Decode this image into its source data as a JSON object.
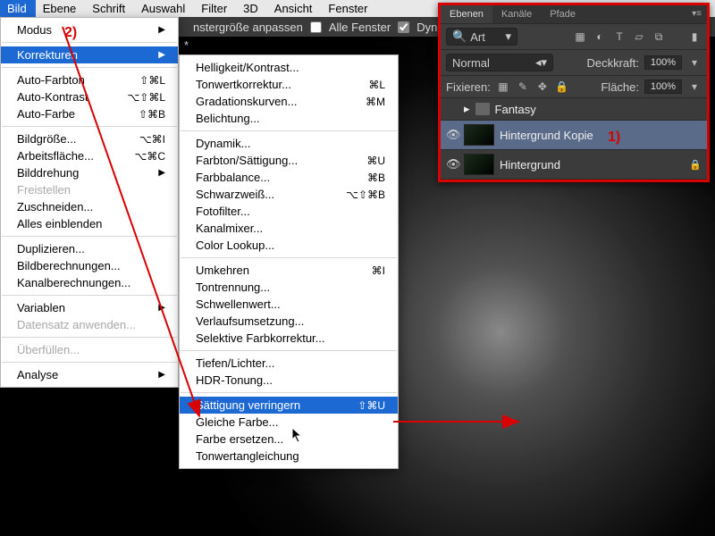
{
  "menubar": [
    "Bild",
    "Ebene",
    "Schrift",
    "Auswahl",
    "Filter",
    "3D",
    "Ansicht",
    "Fenster"
  ],
  "menubar_active_index": 0,
  "toolbar": {
    "fit_label": "nstergröße anpassen",
    "allwin_label": "Alle Fenster",
    "dynzoom_label": "Dynamischer Zo",
    "allwin_checked": false,
    "dynzoom_checked": true
  },
  "tab_title": "*",
  "menu_bild": {
    "modus": "Modus",
    "korrekturen": "Korrekturen",
    "auto_farbton": "Auto-Farbton",
    "auto_farbton_sc": "⇧⌘L",
    "auto_kontrast": "Auto-Kontrast",
    "auto_kontrast_sc": "⌥⇧⌘L",
    "auto_farbe": "Auto-Farbe",
    "auto_farbe_sc": "⇧⌘B",
    "bildgroesse": "Bildgröße...",
    "bildgroesse_sc": "⌥⌘I",
    "arbeitsflaeche": "Arbeitsfläche...",
    "arbeitsflaeche_sc": "⌥⌘C",
    "bilddrehung": "Bilddrehung",
    "freistellen": "Freistellen",
    "zuschneiden": "Zuschneiden...",
    "alles_einblenden": "Alles einblenden",
    "duplizieren": "Duplizieren...",
    "bildberechnungen": "Bildberechnungen...",
    "kanalberechnungen": "Kanalberechnungen...",
    "variablen": "Variablen",
    "datensatz_anwenden": "Datensatz anwenden...",
    "ueberfuellen": "Überfüllen...",
    "analyse": "Analyse"
  },
  "submenu_korr": {
    "helligkeit": "Helligkeit/Kontrast...",
    "tonwert": "Tonwertkorrektur...",
    "tonwert_sc": "⌘L",
    "gradation": "Gradationskurven...",
    "gradation_sc": "⌘M",
    "belichtung": "Belichtung...",
    "dynamik": "Dynamik...",
    "farbton": "Farbton/Sättigung...",
    "farbton_sc": "⌘U",
    "farbbalance": "Farbbalance...",
    "farbbalance_sc": "⌘B",
    "schwarzweiss": "Schwarzweiß...",
    "schwarzweiss_sc": "⌥⇧⌘B",
    "fotofilter": "Fotofilter...",
    "kanalmixer": "Kanalmixer...",
    "colorlookup": "Color Lookup...",
    "umkehren": "Umkehren",
    "umkehren_sc": "⌘I",
    "tontrennung": "Tontrennung...",
    "schwellenwert": "Schwellenwert...",
    "verlauf": "Verlaufsumsetzung...",
    "selektiv": "Selektive Farbkorrektur...",
    "tiefen": "Tiefen/Lichter...",
    "hdr": "HDR-Tonung...",
    "saettigung": "Sättigung verringern",
    "saettigung_sc": "⇧⌘U",
    "gleiche": "Gleiche Farbe...",
    "ersetzen": "Farbe ersetzen...",
    "tonwertangl": "Tonwertangleichung"
  },
  "panel": {
    "tab_ebenen": "Ebenen",
    "tab_kanaele": "Kanäle",
    "tab_pfade": "Pfade",
    "search_mode": "Art",
    "blend": "Normal",
    "opacity_label": "Deckkraft:",
    "opacity": "100%",
    "lock_label": "Fixieren:",
    "fill_label": "Fläche:",
    "fill": "100%",
    "group": "Fantasy",
    "layer1": "Hintergrund Kopie",
    "layer2": "Hintergrund"
  },
  "annotations": {
    "a1": "1)",
    "a2": "2)"
  }
}
